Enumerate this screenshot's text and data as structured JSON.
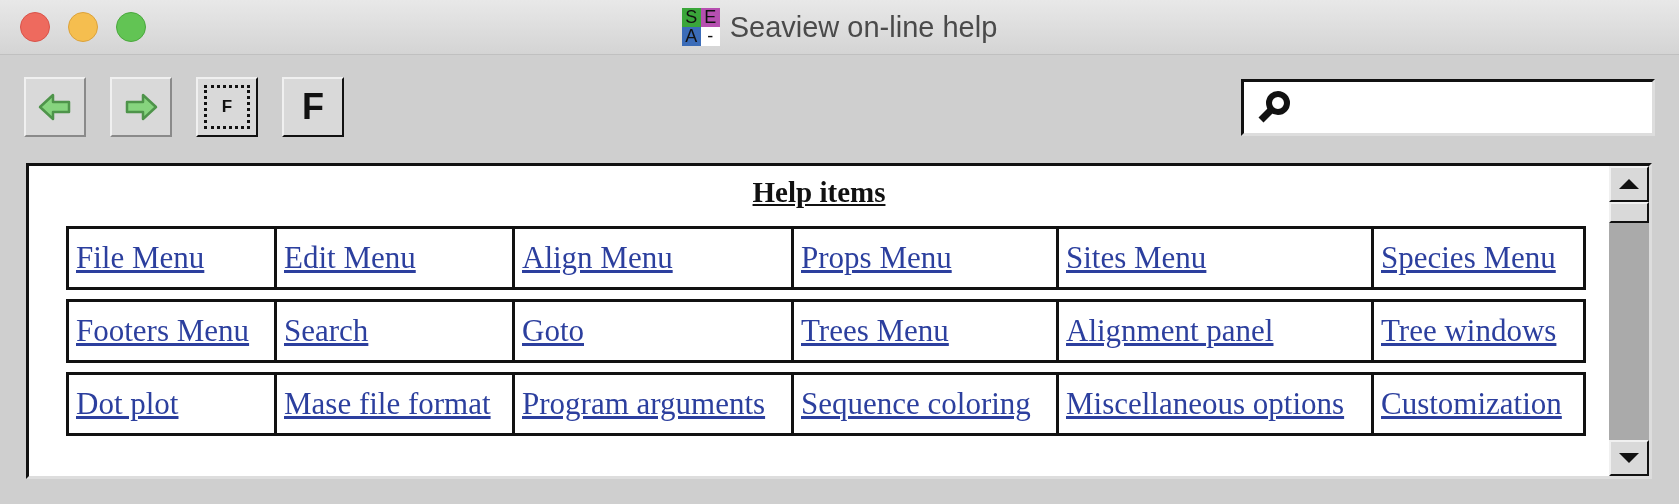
{
  "window": {
    "title": "Seaview on-line help",
    "logo_letters": [
      "S",
      "E",
      "A",
      "-"
    ]
  },
  "toolbar": {
    "buttons": [
      {
        "kind": "back"
      },
      {
        "kind": "forward"
      },
      {
        "kind": "font-small",
        "label": "F"
      },
      {
        "kind": "font-large",
        "label": "F"
      }
    ]
  },
  "content": {
    "heading": "Help items",
    "rows": [
      [
        "File Menu",
        "Edit Menu",
        "Align Menu",
        "Props Menu",
        "Sites Menu",
        "Species Menu"
      ],
      [
        "Footers Menu",
        "Search",
        "Goto",
        "Trees Menu",
        "Alignment panel",
        "Tree windows"
      ],
      [
        "Dot plot",
        "Mase file format",
        "Program arguments",
        "Sequence coloring",
        "Miscellaneous options",
        "Customization"
      ]
    ]
  }
}
